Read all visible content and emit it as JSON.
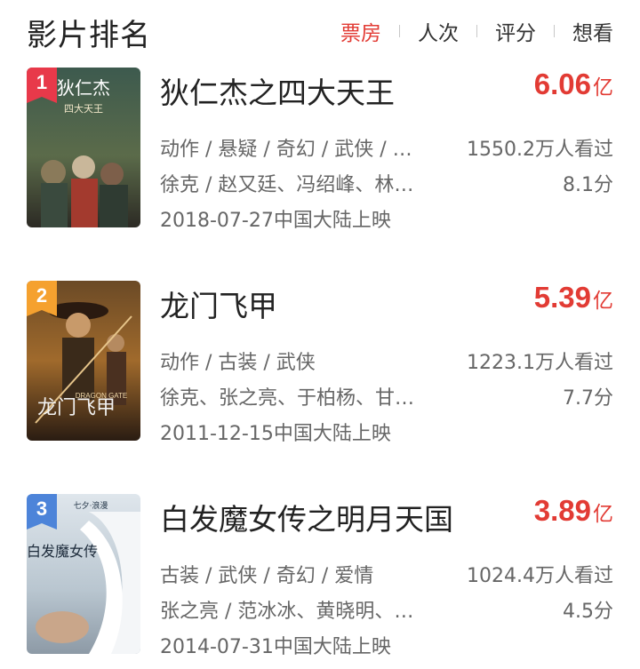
{
  "header": {
    "title": "影片排名",
    "tabs": [
      {
        "label": "票房",
        "active": true
      },
      {
        "label": "人次",
        "active": false
      },
      {
        "label": "评分",
        "active": false
      },
      {
        "label": "想看",
        "active": false
      }
    ]
  },
  "colors": {
    "accent": "#e23b34",
    "rank_1": "#e8394a",
    "rank_2": "#f5a12f",
    "rank_3": "#4d84d9"
  },
  "movies": [
    {
      "rank": "1",
      "title": "狄仁杰之四大天王",
      "box_office_value": "6.06",
      "box_office_unit": "亿",
      "genres": "动作 / 悬疑 / 奇幻 / 武侠 / …",
      "views": "1550.2万人看过",
      "cast": "徐克 / 赵又廷、冯绍峰、林…",
      "rating": "8.1分",
      "release": "2018-07-27中国大陆上映",
      "poster_text": "狄仁杰",
      "poster_subtext": "四大天王"
    },
    {
      "rank": "2",
      "title": "龙门飞甲",
      "box_office_value": "5.39",
      "box_office_unit": "亿",
      "genres": "动作 / 古装 / 武侠",
      "views": "1223.1万人看过",
      "cast": "徐克、张之亮、于柏杨、甘…",
      "rating": "7.7分",
      "release": "2011-12-15中国大陆上映",
      "poster_text": "龙门飞甲",
      "poster_subtext": "DRAGON GATE"
    },
    {
      "rank": "3",
      "title": "白发魔女传之明月天国",
      "box_office_value": "3.89",
      "box_office_unit": "亿",
      "genres": "古装 / 武侠 / 奇幻 / 爱情",
      "views": "1024.4万人看过",
      "cast": "张之亮 / 范冰冰、黄晓明、…",
      "rating": "4.5分",
      "release": "2014-07-31中国大陆上映",
      "poster_text": "白发魔女传",
      "poster_subtext": "七夕·浪漫"
    }
  ]
}
